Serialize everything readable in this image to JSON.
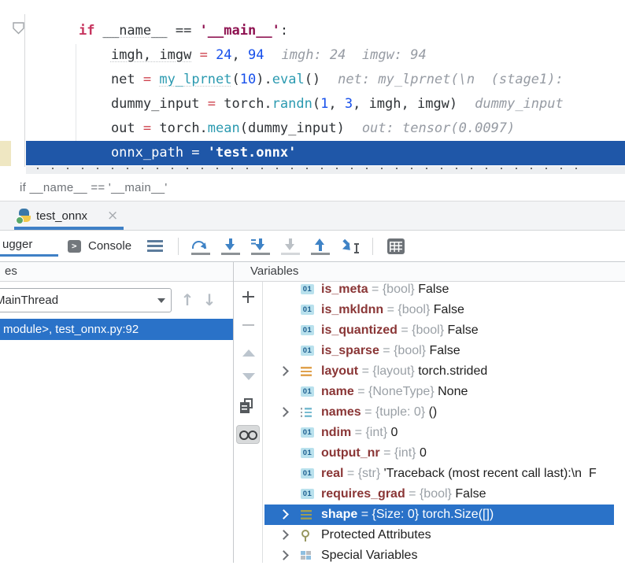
{
  "colors": {
    "selection_blue": "#2a72c8",
    "execution_line_blue": "#1f57a8",
    "tab_accent_blue": "#3f80c6"
  },
  "editor": {
    "lines": [
      {
        "tokens": [
          {
            "t": "if ",
            "c": "kw"
          },
          {
            "t": "__name__",
            "c": "pl sq"
          },
          {
            "t": " == ",
            "c": "pl"
          },
          {
            "t": "'__main__'",
            "c": "str"
          },
          {
            "t": ":",
            "c": "pl"
          }
        ]
      },
      {
        "tokens": [
          {
            "t": "    ",
            "c": "pl"
          },
          {
            "t": "imgh, imgw",
            "c": "pl sq"
          },
          {
            "t": " ",
            "c": "pl"
          },
          {
            "t": "=",
            "c": "op"
          },
          {
            "t": " ",
            "c": "pl"
          },
          {
            "t": "24",
            "c": "num"
          },
          {
            "t": ", ",
            "c": "pl"
          },
          {
            "t": "94",
            "c": "num"
          }
        ],
        "hint": "imgh: 24  imgw: 94"
      },
      {
        "tokens": [
          {
            "t": "    net ",
            "c": "pl"
          },
          {
            "t": "=",
            "c": "op"
          },
          {
            "t": " ",
            "c": "pl"
          },
          {
            "t": "my_lprnet",
            "c": "fn sq"
          },
          {
            "t": "(",
            "c": "pl"
          },
          {
            "t": "10",
            "c": "num"
          },
          {
            "t": ").",
            "c": "pl"
          },
          {
            "t": "eval",
            "c": "fn"
          },
          {
            "t": "()",
            "c": "pl"
          }
        ],
        "hint": "net: my_lprnet(\\n  (stage1):"
      },
      {
        "tokens": [
          {
            "t": "    dummy_input ",
            "c": "pl"
          },
          {
            "t": "=",
            "c": "op"
          },
          {
            "t": " torch.",
            "c": "pl"
          },
          {
            "t": "randn",
            "c": "fn"
          },
          {
            "t": "(",
            "c": "pl"
          },
          {
            "t": "1",
            "c": "num"
          },
          {
            "t": ", ",
            "c": "pl"
          },
          {
            "t": "3",
            "c": "num"
          },
          {
            "t": ", imgh, imgw)",
            "c": "pl"
          }
        ],
        "hint": "dummy_input"
      },
      {
        "tokens": [
          {
            "t": "    out ",
            "c": "pl"
          },
          {
            "t": "=",
            "c": "op"
          },
          {
            "t": " torch.",
            "c": "pl"
          },
          {
            "t": "mean",
            "c": "fn"
          },
          {
            "t": "(dummy_input)",
            "c": "pl"
          }
        ],
        "hint": "out: tensor(0.0097)"
      },
      {
        "selected": true,
        "tokens": [
          {
            "t": "    onnx_path ",
            "c": "pl"
          },
          {
            "t": "=",
            "c": "op"
          },
          {
            "t": " ",
            "c": "pl"
          },
          {
            "t": "'test.onnx'",
            "c": "str"
          }
        ]
      }
    ]
  },
  "breadcrumb": {
    "text": "if __name__ == '__main__'"
  },
  "file_tab": {
    "label": "test_onnx",
    "close_glyph": "×"
  },
  "debug_toolbar": {
    "debugger_tab": "ugger",
    "console_tab": "Console",
    "icons": [
      "settings-menu",
      "|",
      "step-over",
      "step-into",
      "force-step-into",
      "step-into-my-code",
      "step-out",
      "run-to-cursor",
      "|",
      "evaluate-expression"
    ]
  },
  "frames": {
    "header": "es",
    "thread_dropdown": "MainThread",
    "selected_frame": "module>, test_onnx.py:92"
  },
  "variables": {
    "header": "Variables",
    "primitive_badge": "01",
    "separator": " = ",
    "side_toolbar": [
      {
        "icon": "add"
      },
      {
        "icon": "remove",
        "disabled": true
      },
      {
        "icon": "scroll-up",
        "disabled": true
      },
      {
        "icon": "scroll-down",
        "disabled": true
      },
      {
        "icon": "duplicate"
      },
      {
        "icon": "glasses",
        "toggled": true
      }
    ],
    "rows": [
      {
        "kind": "primitive",
        "name": "is_meta",
        "type": "{bool}",
        "value": "False"
      },
      {
        "kind": "primitive",
        "name": "is_mkldnn",
        "type": "{bool}",
        "value": "False"
      },
      {
        "kind": "primitive",
        "name": "is_quantized",
        "type": "{bool}",
        "value": "False"
      },
      {
        "kind": "primitive",
        "name": "is_sparse",
        "type": "{bool}",
        "value": "False"
      },
      {
        "kind": "list-orange",
        "name": "layout",
        "type": "{layout}",
        "value": "torch.strided",
        "expand": true
      },
      {
        "kind": "primitive",
        "name": "name",
        "type": "{NoneType}",
        "value": "None"
      },
      {
        "kind": "list-numbered",
        "name": "names",
        "type": "{tuple: 0}",
        "value": "()",
        "expand": true
      },
      {
        "kind": "primitive",
        "name": "ndim",
        "type": "{int}",
        "value": "0"
      },
      {
        "kind": "primitive",
        "name": "output_nr",
        "type": "{int}",
        "value": "0"
      },
      {
        "kind": "primitive",
        "name": "real",
        "type": "{str}",
        "value": "'Traceback (most recent call last):\\n  F"
      },
      {
        "kind": "primitive",
        "name": "requires_grad",
        "type": "{bool}",
        "value": "False"
      },
      {
        "kind": "list-olive",
        "name": "shape",
        "type": "{Size: 0}",
        "value": "torch.Size([])",
        "expand": true,
        "selected": true
      },
      {
        "kind": "key",
        "label": "Protected Attributes",
        "expand": true
      },
      {
        "kind": "squares",
        "label": "Special Variables",
        "expand": true
      }
    ]
  }
}
